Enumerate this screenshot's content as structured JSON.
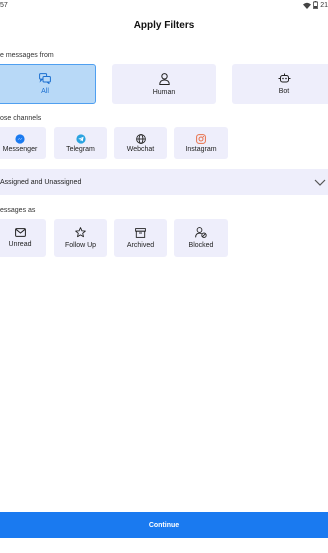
{
  "status_bar": {
    "time": "57",
    "battery": "21"
  },
  "title": "Apply Filters",
  "source_section": {
    "label": "e messages from",
    "options": [
      {
        "label": "All",
        "icon": "chat-bubbles-icon",
        "selected": true
      },
      {
        "label": "Human",
        "icon": "person-icon",
        "selected": false
      },
      {
        "label": "Bot",
        "icon": "bot-icon",
        "selected": false
      }
    ]
  },
  "channels_section": {
    "label": "ose channels",
    "options": [
      {
        "label": "Messenger",
        "icon": "messenger-icon",
        "color": "#1a7af0"
      },
      {
        "label": "Telegram",
        "icon": "telegram-icon",
        "color": "#2aa3e0"
      },
      {
        "label": "Webchat",
        "icon": "globe-icon",
        "color": "#222222"
      },
      {
        "label": "Instagram",
        "icon": "instagram-icon",
        "color": "#e8704a"
      }
    ]
  },
  "assignment_dropdown": {
    "value": "Assigned and Unassigned"
  },
  "status_section": {
    "label": "essages as",
    "options": [
      {
        "label": "Unread",
        "icon": "mail-icon"
      },
      {
        "label": "Follow Up",
        "icon": "star-icon"
      },
      {
        "label": "Archived",
        "icon": "archive-icon"
      },
      {
        "label": "Blocked",
        "icon": "blocked-user-icon"
      }
    ]
  },
  "continue_button": {
    "label": "Continue"
  },
  "colors": {
    "accent": "#1a7af0",
    "card_bg": "#eeeefb",
    "selected_bg": "#b8d9f7"
  }
}
